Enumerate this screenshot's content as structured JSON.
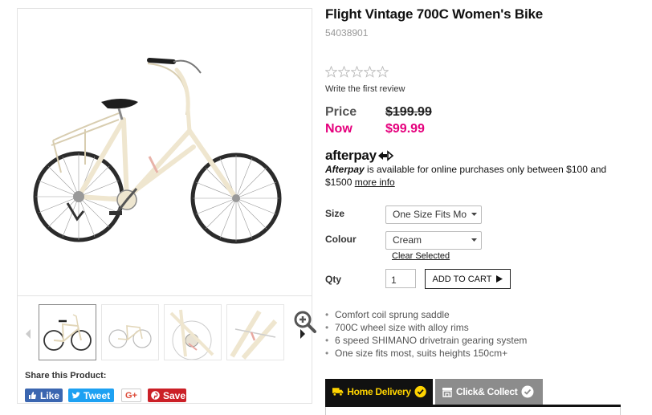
{
  "product": {
    "title": "Flight Vintage 700C Women's Bike",
    "sku": "54038901",
    "review_link": "Write the first review",
    "star_count": 5,
    "rating": 0
  },
  "pricing": {
    "was_label": "Price",
    "was_value": "$199.99",
    "now_label": "Now",
    "now_value": "$99.99",
    "now_color": "#e5007d"
  },
  "afterpay": {
    "logo_text": "afterpay",
    "brand_word": "Afterpay",
    "message": " is available for online purchases only between $100 and $1500 ",
    "more_info": "more info"
  },
  "options": {
    "size_label": "Size",
    "size_value": "One Size Fits Mo",
    "colour_label": "Colour",
    "colour_value": "Cream",
    "clear_selected": "Clear Selected",
    "qty_label": "Qty",
    "qty_value": "1",
    "add_to_cart": "ADD TO CART"
  },
  "features": [
    "Comfort coil sprung saddle",
    "700C wheel size with alloy rims",
    "6 speed SHIMANO drivetrain gearing system",
    "One size fits most, suits heights 150cm+"
  ],
  "delivery_tabs": {
    "home": "Home Delivery",
    "click": "Click& Collect",
    "home_icon": "truck-icon",
    "click_icon": "store-icon"
  },
  "share": {
    "title": "Share this Product:",
    "like": "Like",
    "tweet": "Tweet",
    "gplus": "G+",
    "save": "Save"
  },
  "gallery": {
    "main_image": "cream-vintage-bike-photo",
    "thumbnails": [
      "bike-side-view",
      "bike-side-view-small",
      "bike-drivetrain-closeup",
      "bike-frame-closeup"
    ],
    "zoom_icon": "zoom-in-icon"
  },
  "colors": {
    "accent_pink": "#e5007d",
    "tab_active_bg": "#111111",
    "tab_active_text": "#ffd400",
    "tab_inactive_bg": "#8c8c8c",
    "bike_cream": "#efe6cf"
  }
}
